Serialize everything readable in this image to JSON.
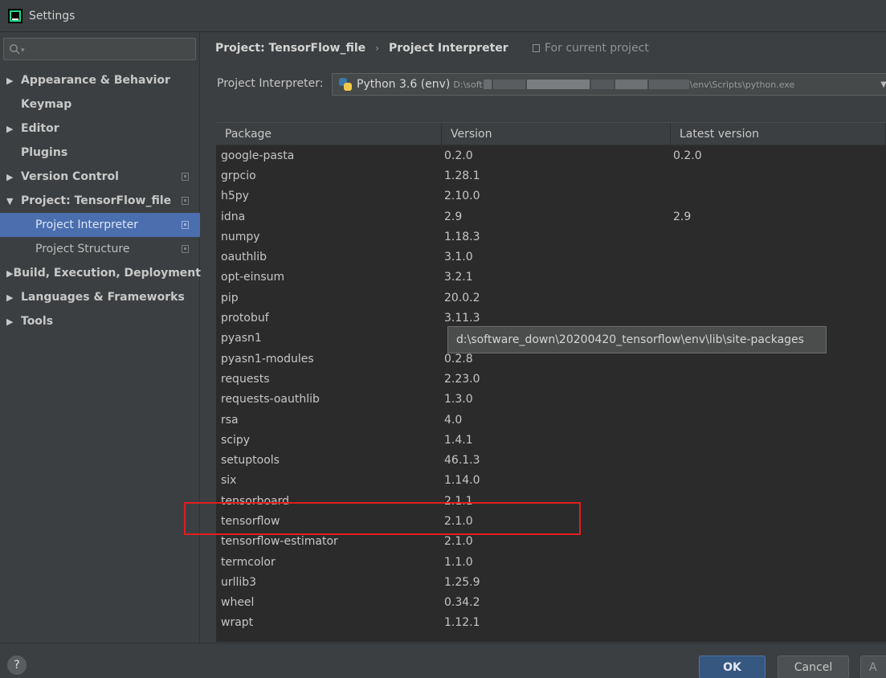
{
  "window": {
    "title": "Settings"
  },
  "search": {
    "placeholder": ""
  },
  "sidebar": {
    "items": [
      {
        "label": "Appearance & Behavior",
        "arrow": "▶"
      },
      {
        "label": "Keymap"
      },
      {
        "label": "Editor",
        "arrow": "▶"
      },
      {
        "label": "Plugins"
      },
      {
        "label": "Version Control",
        "arrow": "▶"
      },
      {
        "label": "Project: TensorFlow_file",
        "arrow": "▼"
      },
      {
        "label": "Project Interpreter"
      },
      {
        "label": "Project Structure"
      },
      {
        "label": "Build, Execution, Deployment",
        "arrow": "▶"
      },
      {
        "label": "Languages & Frameworks",
        "arrow": "▶"
      },
      {
        "label": "Tools",
        "arrow": "▶"
      }
    ]
  },
  "header": {
    "crumb1": "Project: TensorFlow_file",
    "separator": "›",
    "crumb2": "Project Interpreter",
    "for_current": "For current project"
  },
  "interpreter": {
    "label": "Project Interpreter:",
    "name": "Python 3.6 (env)",
    "path_prefix": "D:\\soft",
    "path_suffix": "\\env\\Scripts\\python.exe"
  },
  "table": {
    "columns": [
      "Package",
      "Version",
      "Latest version"
    ],
    "rows": [
      [
        "google-pasta",
        "0.2.0",
        "0.2.0"
      ],
      [
        "grpcio",
        "1.28.1",
        ""
      ],
      [
        "h5py",
        "2.10.0",
        ""
      ],
      [
        "idna",
        "2.9",
        "2.9"
      ],
      [
        "numpy",
        "1.18.3",
        ""
      ],
      [
        "oauthlib",
        "3.1.0",
        ""
      ],
      [
        "opt-einsum",
        "3.2.1",
        ""
      ],
      [
        "pip",
        "20.0.2",
        ""
      ],
      [
        "protobuf",
        "3.11.3",
        ""
      ],
      [
        "pyasn1",
        "",
        ""
      ],
      [
        "pyasn1-modules",
        "0.2.8",
        ""
      ],
      [
        "requests",
        "2.23.0",
        ""
      ],
      [
        "requests-oauthlib",
        "1.3.0",
        ""
      ],
      [
        "rsa",
        "4.0",
        ""
      ],
      [
        "scipy",
        "1.4.1",
        ""
      ],
      [
        "setuptools",
        "46.1.3",
        ""
      ],
      [
        "six",
        "1.14.0",
        ""
      ],
      [
        "tensorboard",
        "2.1.1",
        ""
      ],
      [
        "tensorflow",
        "2.1.0",
        ""
      ],
      [
        "tensorflow-estimator",
        "2.1.0",
        ""
      ],
      [
        "termcolor",
        "1.1.0",
        ""
      ],
      [
        "urllib3",
        "1.25.9",
        ""
      ],
      [
        "wheel",
        "0.34.2",
        ""
      ],
      [
        "wrapt",
        "1.12.1",
        ""
      ]
    ]
  },
  "tooltip": {
    "text": "d:\\software_down\\20200420_tensorflow\\env\\lib\\site-packages"
  },
  "footer": {
    "help": "?",
    "ok": "OK",
    "cancel": "Cancel",
    "apply": "A"
  },
  "colors": {
    "accent": "#4b6eaf",
    "ok_button": "#365880",
    "highlight": "#e01e1e"
  }
}
